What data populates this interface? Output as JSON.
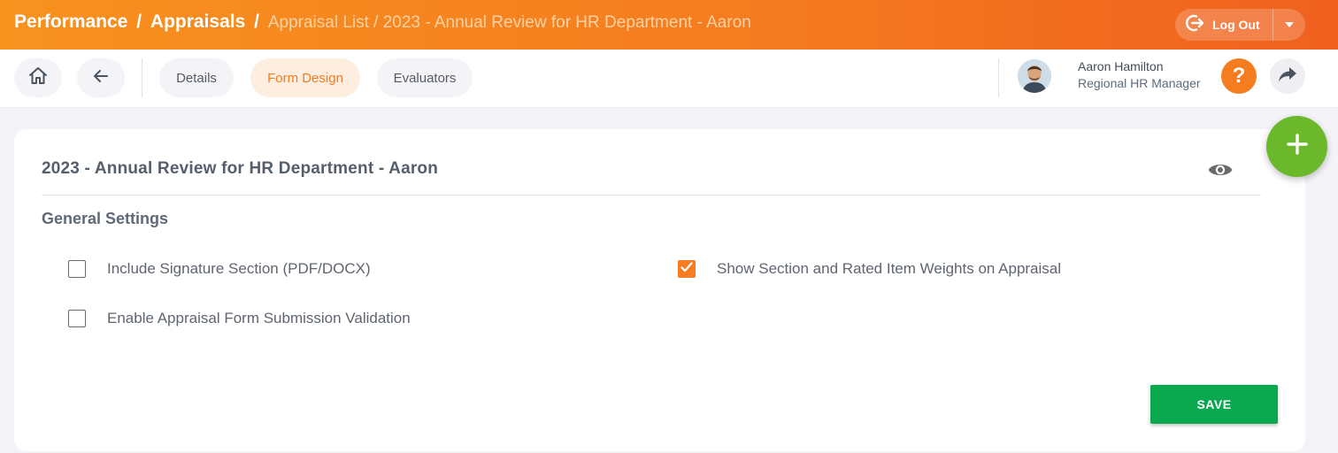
{
  "header": {
    "breadcrumb": {
      "root": "Performance",
      "section": "Appraisals",
      "separator": "/",
      "trail": "Appraisal List / 2023 - Annual Review for HR Department - Aaron"
    },
    "logout_label": "Log Out"
  },
  "nav": {
    "tabs": [
      {
        "label": "Details",
        "active": false
      },
      {
        "label": "Form Design",
        "active": true
      },
      {
        "label": "Evaluators",
        "active": false
      }
    ]
  },
  "user": {
    "name": "Aaron Hamilton",
    "role": "Regional HR Manager"
  },
  "help_symbol": "?",
  "card": {
    "title": "2023 - Annual Review for HR Department - Aaron",
    "section_title": "General Settings",
    "options": [
      {
        "label": "Include Signature Section (PDF/DOCX)",
        "checked": false
      },
      {
        "label": "Show Section and Rated Item Weights on Appraisal",
        "checked": true
      },
      {
        "label": "Enable Appraisal Form Submission Validation",
        "checked": false
      }
    ],
    "save_label": "SAVE"
  },
  "colors": {
    "accent": "#f57c1f",
    "save": "#0aa84f",
    "fab": "#6bb82a"
  },
  "icons": [
    "home-icon",
    "arrow-left-icon",
    "logout-icon",
    "caret-down-icon",
    "help-icon",
    "share-icon",
    "eye-icon",
    "plus-icon",
    "check-icon"
  ]
}
